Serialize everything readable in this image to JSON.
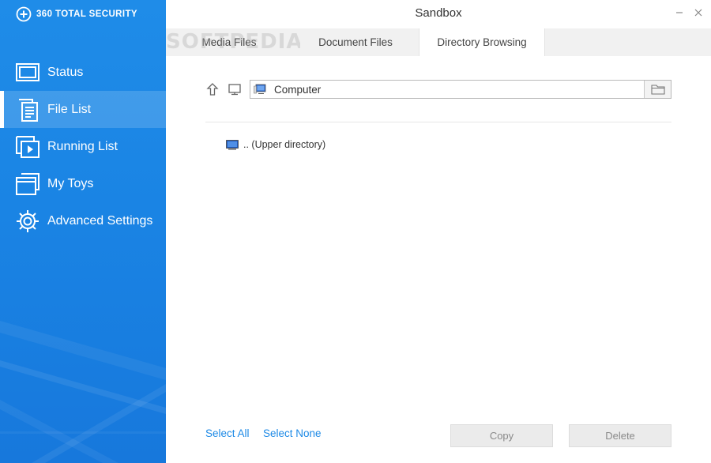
{
  "sidebar": {
    "brand": "360 TOTAL SECURITY",
    "items": [
      {
        "label": "Status",
        "icon": "monitor-icon",
        "active": false
      },
      {
        "label": "File List",
        "icon": "document-icon",
        "active": true
      },
      {
        "label": "Running List",
        "icon": "play-window-icon",
        "active": false
      },
      {
        "label": "My Toys",
        "icon": "stacked-windows-icon",
        "active": false
      },
      {
        "label": "Advanced Settings",
        "icon": "gear-icon",
        "active": false
      }
    ]
  },
  "window": {
    "title": "Sandbox",
    "minimize_icon": "minimize-icon",
    "close_icon": "close-icon"
  },
  "tabs": [
    {
      "label": "Media Files",
      "active": false
    },
    {
      "label": "Document Files",
      "active": false
    },
    {
      "label": "Directory Browsing",
      "active": true
    }
  ],
  "watermark": "SOFTPEDIA",
  "browser": {
    "path": "Computer",
    "up_icon": "up-arrow-icon",
    "computer_icon": "computer-icon",
    "browse_icon": "folder-icon",
    "entries": [
      {
        "label": ".. (Upper directory)",
        "icon": "computer-icon"
      }
    ]
  },
  "footer": {
    "select_all": "Select All",
    "select_none": "Select None",
    "copy": "Copy",
    "delete": "Delete"
  },
  "colors": {
    "sidebar": "#1a84e4",
    "accent": "#1e8ae6",
    "button_bg": "#ebebeb",
    "button_text": "#8a8a8a"
  }
}
